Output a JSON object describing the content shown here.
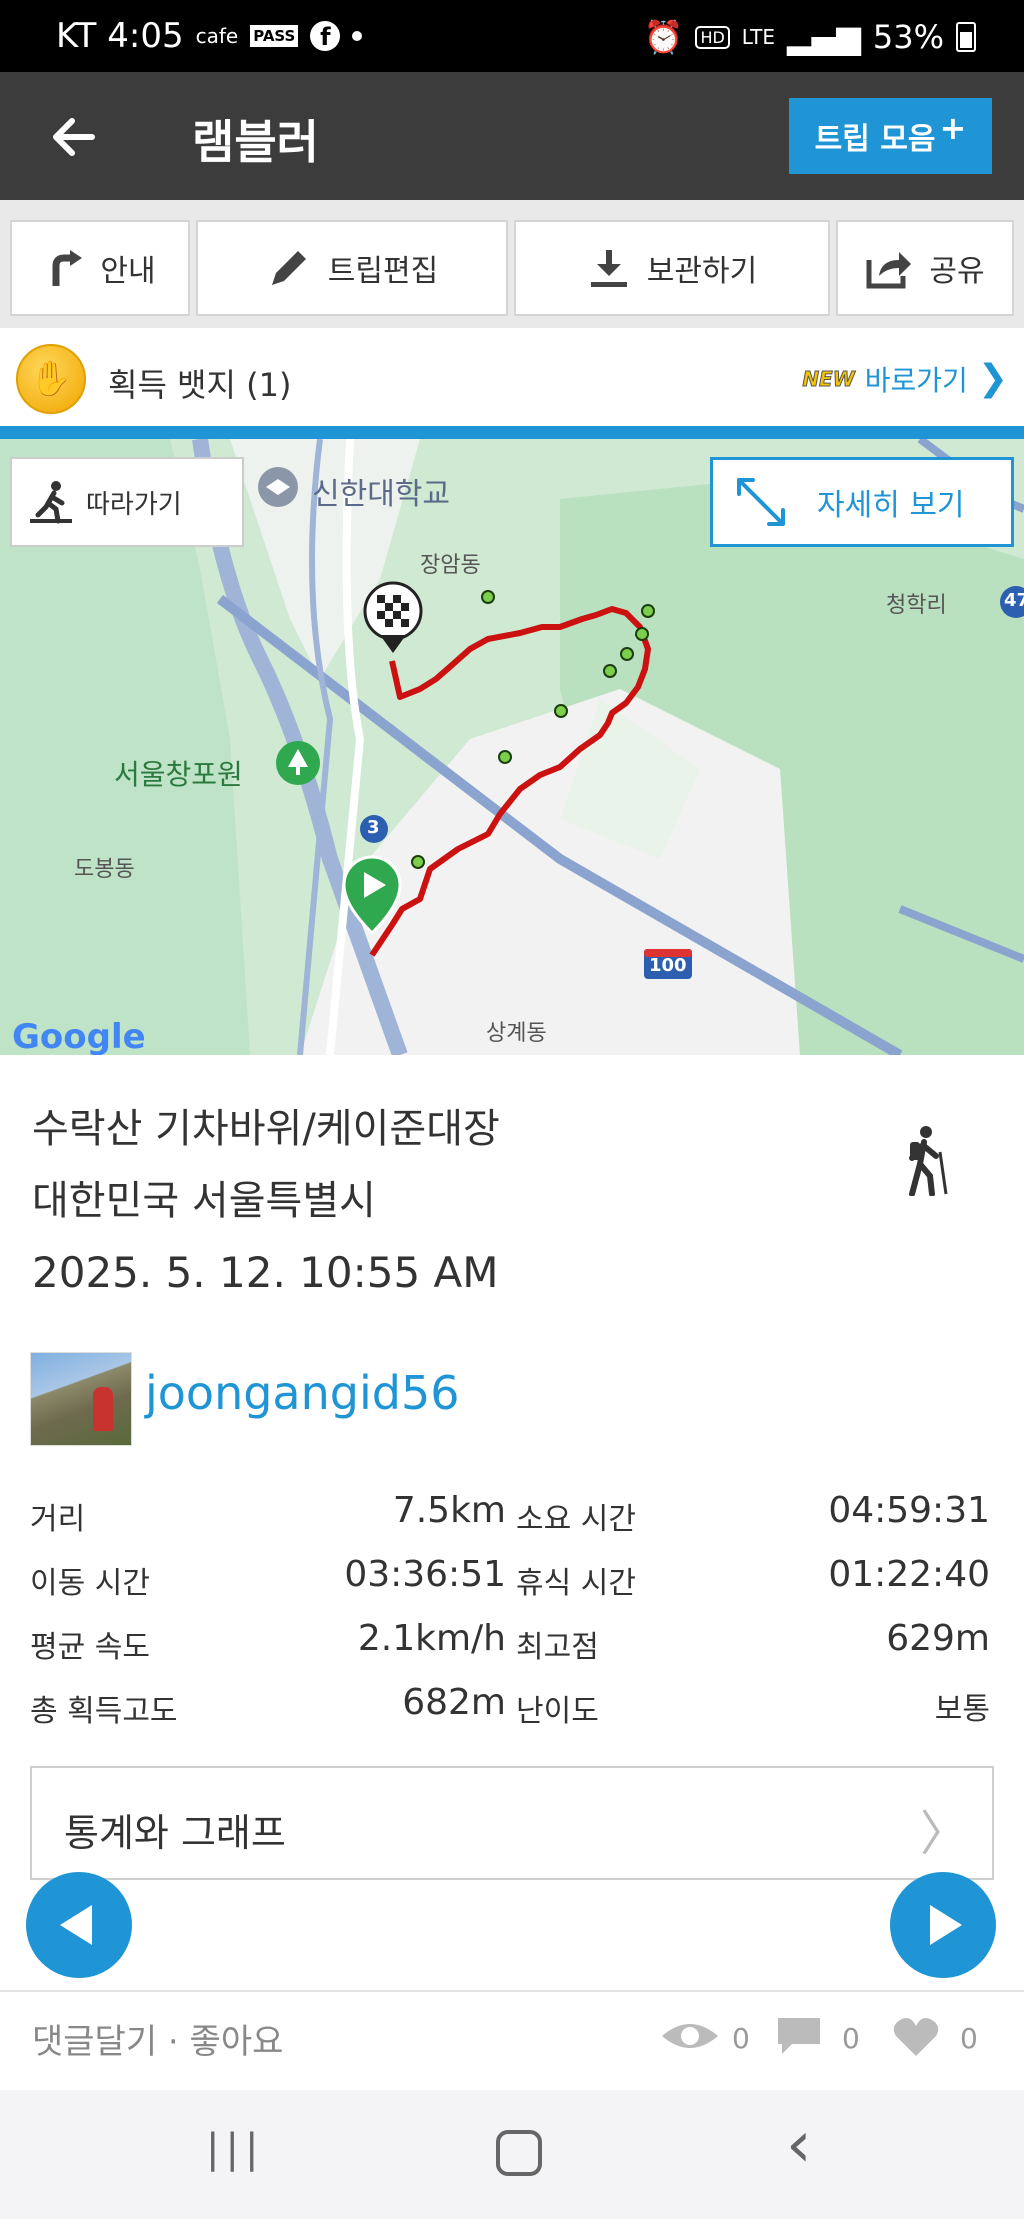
{
  "status_bar": {
    "carrier_time": "KT 4:05",
    "cafe": "cafe",
    "pass": "PASS",
    "hd": "HD",
    "network": "LTE",
    "battery": "53%"
  },
  "app_bar": {
    "title": "램블러",
    "trip_collection_label": "트립 모음",
    "trip_collection_plus": "+"
  },
  "toolbar": {
    "guide_label": "안내",
    "edit_trip_label": "트립편집",
    "save_label": "보관하기",
    "share_label": "공유"
  },
  "badge": {
    "label": "획득 뱃지 (1)",
    "new_tag": "NEW",
    "shortcut_label": "바로가기"
  },
  "map": {
    "follow_label": "따라가기",
    "detail_view_label": "자세히 보기",
    "places": {
      "university": "신한대학교",
      "jangam": "장암동",
      "changpo": "서울창포원",
      "dobong": "도봉동",
      "cheonghak": "청학리",
      "sanggye": "상계동",
      "route3": "3",
      "route100": "100",
      "route47": "47"
    },
    "google": "Google"
  },
  "trip": {
    "title": "수락산 기차바위/케이준대장",
    "location": "대한민국 서울특별시",
    "date": "2025. 5. 12. 10:55 AM"
  },
  "user": {
    "username": "joongangid56"
  },
  "stats": {
    "distance_label": "거리",
    "distance_value": "7.5km",
    "duration_label": "소요 시간",
    "duration_value": "04:59:31",
    "moving_time_label": "이동 시간",
    "moving_time_value": "03:36:51",
    "rest_time_label": "휴식 시간",
    "rest_time_value": "01:22:40",
    "avg_speed_label": "평균 속도",
    "avg_speed_value": "2.1km/h",
    "max_alt_label": "최고점",
    "max_alt_value": "629m",
    "total_gain_label": "총 획득고도",
    "total_gain_value": "682m",
    "difficulty_label": "난이도",
    "difficulty_value": "보통"
  },
  "stats_graph": {
    "label": "통계와 그래프",
    "chevron": "〉"
  },
  "footer": {
    "comments_label": "댓글달기 · 좋아요",
    "views": "0",
    "comments": "0",
    "likes": "0"
  },
  "nav_bar": {
    "recent": "|||",
    "back": "‹"
  },
  "colors": {
    "accent": "#1f95d6",
    "app_bar": "#3c3c3c",
    "route": "#cc1111"
  }
}
